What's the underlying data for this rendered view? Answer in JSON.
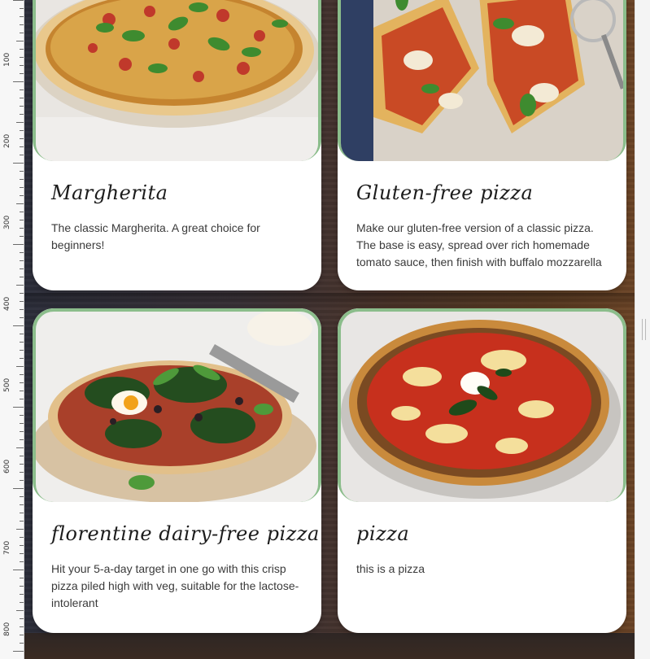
{
  "ruler": {
    "labels": [
      "100",
      "200",
      "300",
      "400",
      "500",
      "600",
      "700",
      "800"
    ]
  },
  "cards": [
    {
      "title": "Margherita",
      "description": "The classic Margherita. A great choice for beginners!",
      "image": "margherita-pizza-photo"
    },
    {
      "title": "Gluten-free pizza",
      "description": "Make our gluten-free version of a classic pizza. The base is easy, spread over rich homemade tomato sauce, then finish with buffalo mozzarella",
      "image": "gluten-free-pizza-photo"
    },
    {
      "title": "florentine dairy-free pizza",
      "description": "Hit your 5-a-day target in one go with this crisp pizza piled high with veg, suitable for the lactose-intolerant",
      "image": "florentine-pizza-photo"
    },
    {
      "title": "pizza",
      "description": "this is a pizza",
      "image": "neapolitan-pizza-photo"
    }
  ],
  "colors": {
    "card_border_accent": "#8bbd8b",
    "card_background": "#ffffff",
    "stage_wood_dark": "#2c2e3a",
    "stage_wood_warm": "#6b4426"
  }
}
